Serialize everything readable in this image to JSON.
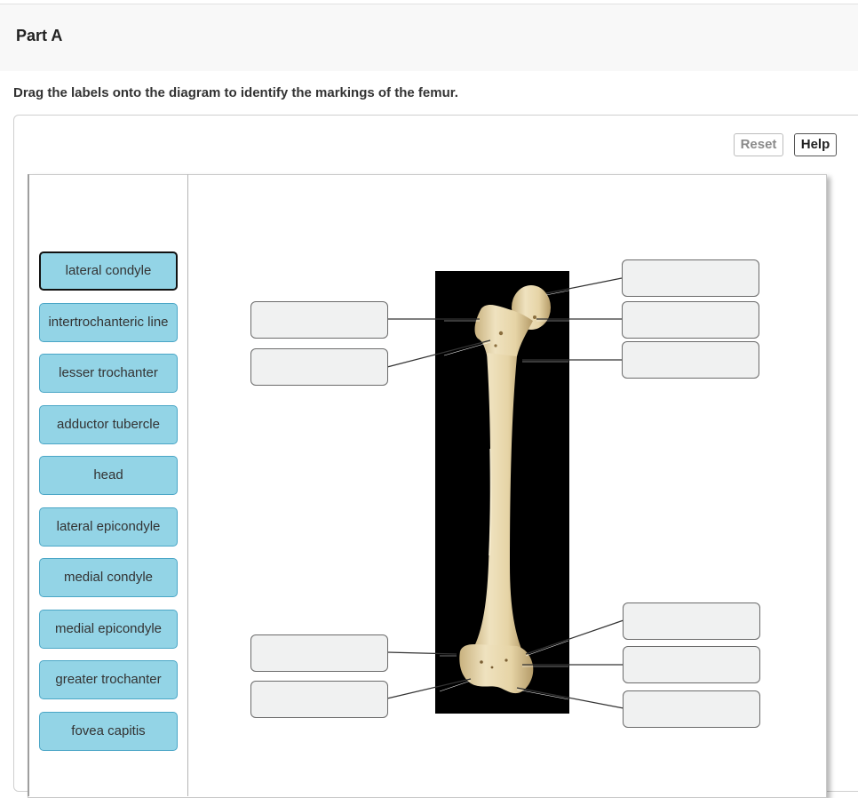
{
  "part": {
    "title": "Part A"
  },
  "instructions": "Drag the labels onto the diagram to identify the markings of the femur.",
  "toolbar": {
    "reset_label": "Reset",
    "help_label": "Help"
  },
  "label_bank": [
    "lateral condyle",
    "intertrochanteric line",
    "lesser trochanter",
    "adductor tubercle",
    "head",
    "lateral epicondyle",
    "medial condyle",
    "medial epicondyle",
    "greater trochanter",
    "fovea capitis"
  ],
  "colors": {
    "label_fill": "#93d4e6",
    "label_border": "#4aa6c6",
    "target_fill": "#f0f1f1",
    "photo_background": "#000000",
    "bone": "#e9d9b0"
  }
}
